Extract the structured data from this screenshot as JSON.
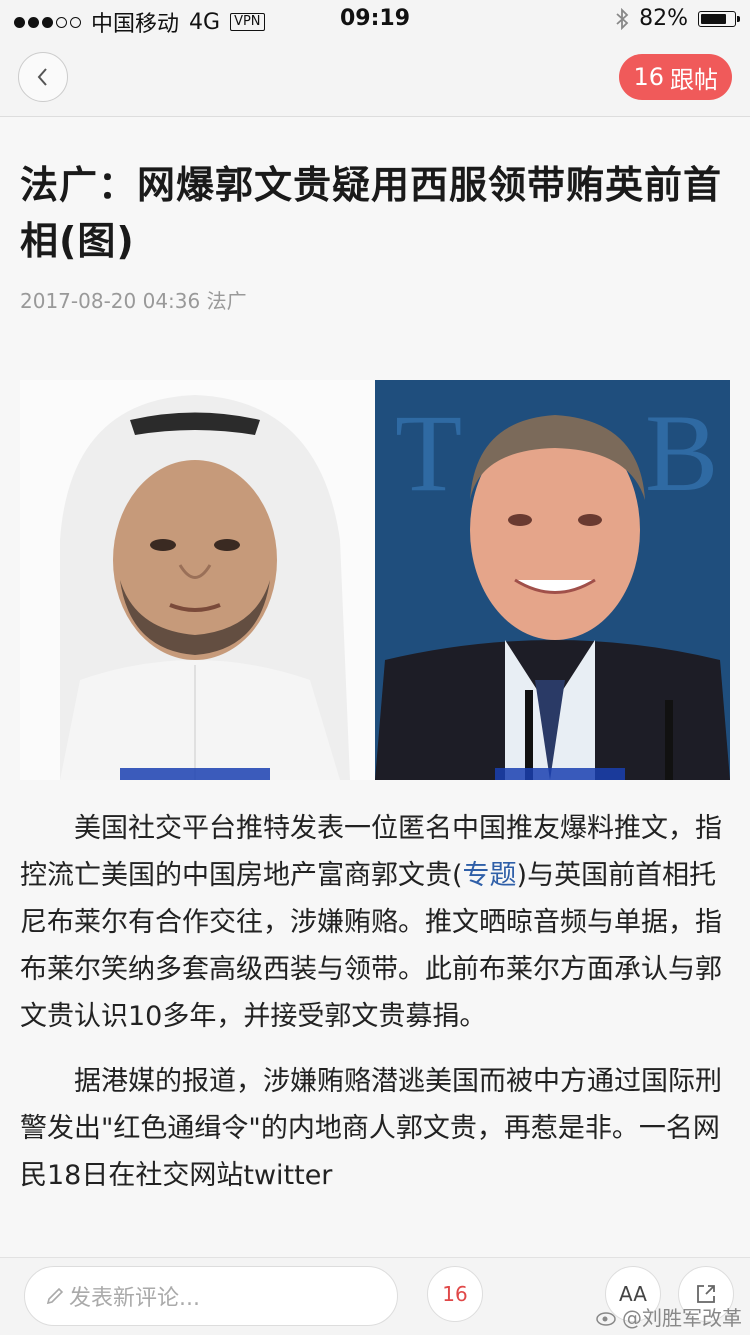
{
  "status_bar": {
    "carrier": "中国移动",
    "network": "4G",
    "vpn": "VPN",
    "time": "09:19",
    "battery_percent": "82%",
    "battery_level": 0.82
  },
  "nav": {
    "follow_count": "16",
    "follow_label": "跟帖"
  },
  "article": {
    "title": "法广：网爆郭文贵疑用西服领带贿英前首相(图)",
    "date": "2017-08-20 04:36",
    "source": "法广",
    "paragraph1_before": "美国社交平台推特发表一位匿名中国推友爆料推文，指控流亡美国的中国房地产富商郭文贵(",
    "paragraph1_link": "专题",
    "paragraph1_after": ")与英国前首相托尼布莱尔有合作交往，涉嫌贿赂。推文晒晾音频与单据，指布莱尔笑纳多套高级西装与领带。此前布莱尔方面承认与郭文贵认识10多年，并接受郭文贵募捐。",
    "paragraph2": "据港媒的报道，涉嫌贿赂潜逃美国而被中方通过国际刑警发出\"红色通缉令\"的内地商人郭文贵，再惹是非。一名网民18日在社交网站twitter"
  },
  "bottom_bar": {
    "comment_placeholder": "发表新评论...",
    "comment_count": "16",
    "font_label": "AA",
    "watermark": "@刘胜军改革"
  },
  "colors": {
    "accent_red": "#f05a5a",
    "link_blue": "#2f5fa8"
  }
}
